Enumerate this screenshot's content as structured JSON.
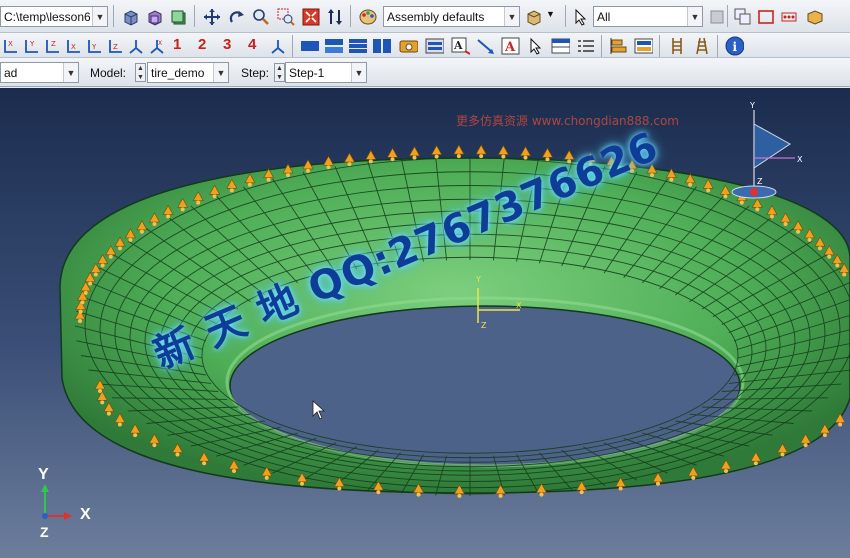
{
  "toolbar1": {
    "path_select": "C:\\temp\\lesson6",
    "render_select": "Assembly defaults",
    "selection_filter": "All"
  },
  "toolbar2": {
    "step_numbers": [
      "1",
      "2",
      "3",
      "4"
    ]
  },
  "toolbar3": {
    "module_select": "ad",
    "model_label": "Model:",
    "model_value": "tire_demo",
    "step_label": "Step:",
    "step_value": "Step-1"
  },
  "viewport": {
    "watermark_top": "更多仿真资源 www.chongdian888.com",
    "watermark_big": "新 天 地 QQ:2767376626",
    "triad": {
      "y": "Y",
      "x": "X",
      "z": "Z"
    }
  },
  "colors": {
    "mesh_fill": "#4fae57",
    "mesh_lines": "#133a1a",
    "load_arrows": "#f0a020",
    "viewport_top": "#1b2c4e",
    "viewport_bottom": "#6d7e9c"
  },
  "icons": [
    "iso-view-icon",
    "front-view-icon",
    "side-view-icon",
    "pan-icon",
    "rotate-icon",
    "zoom-icon",
    "box-zoom-icon",
    "fit-view-icon",
    "cycle-views-icon",
    "render-style-icon",
    "part-instance-icon",
    "select-arrow-icon",
    "info-icon"
  ]
}
